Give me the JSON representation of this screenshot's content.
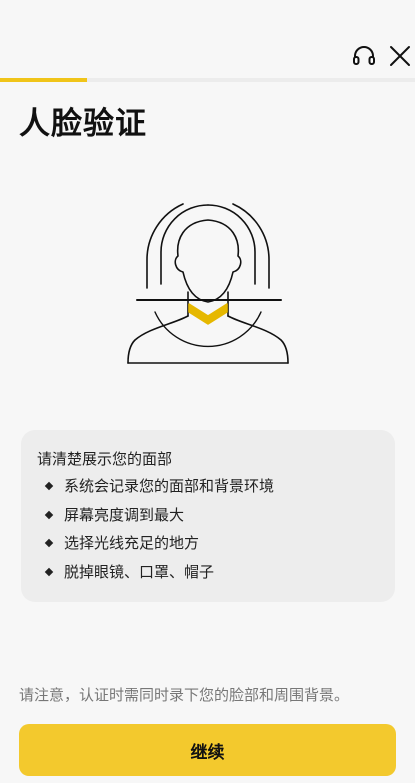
{
  "header": {
    "support_icon": "headset-icon",
    "close_icon": "close-icon",
    "progress_fraction": 0.21
  },
  "page": {
    "title": "人脸验证"
  },
  "illustration": {
    "icon": "face-scan-icon",
    "accent_color": "#e6b800"
  },
  "instructions": {
    "heading": "请清楚展示您的面部",
    "items": [
      "系统会记录您的面部和背景环境",
      "屏幕亮度调到最大",
      "选择光线充足的地方",
      "脱掉眼镜、口罩、帽子"
    ]
  },
  "footer": {
    "notice": "请注意，认证时需同时录下您的脸部和周围背景。",
    "continue_label": "继续"
  },
  "colors": {
    "accent": "#f3c92d",
    "background": "#f7f7f7"
  }
}
